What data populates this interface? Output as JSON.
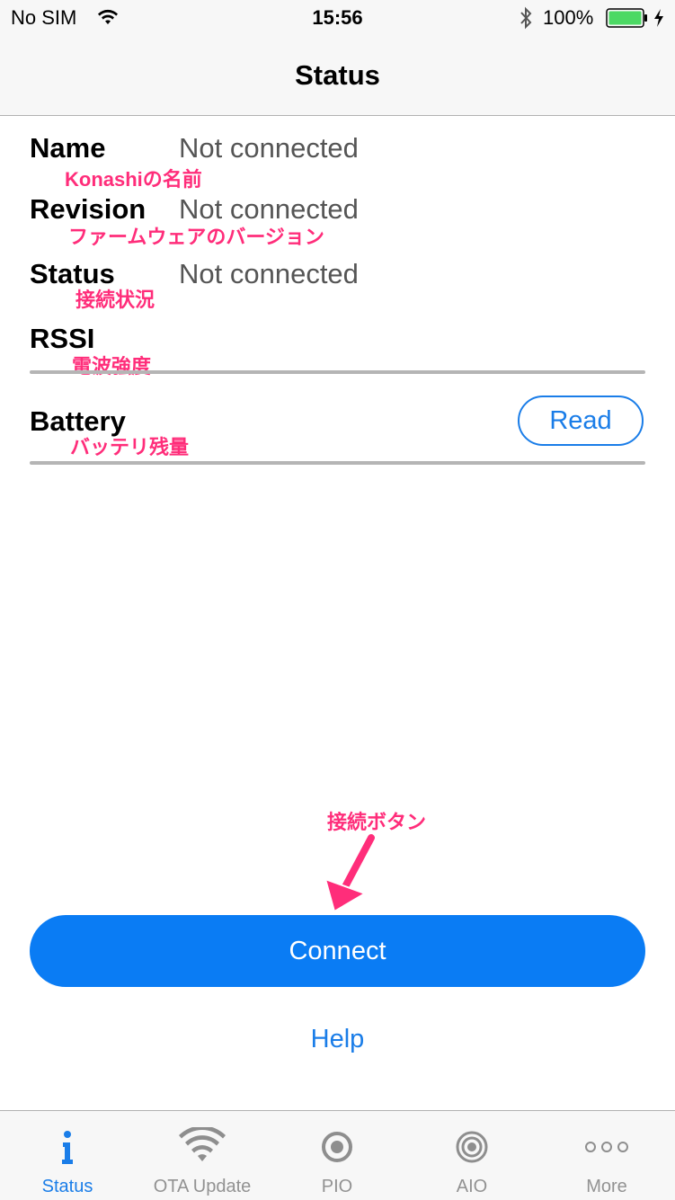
{
  "status_bar": {
    "carrier": "No SIM",
    "time": "15:56",
    "battery_pct": "100%",
    "battery_color": "#4cd964"
  },
  "nav": {
    "title": "Status"
  },
  "rows": {
    "name": {
      "label": "Name",
      "value": "Not connected",
      "annotation": "Konashiの名前"
    },
    "revision": {
      "label": "Revision",
      "value": "Not connected",
      "annotation": "ファームウェアのバージョン"
    },
    "status": {
      "label": "Status",
      "value": "Not connected",
      "annotation": "接続状況"
    },
    "rssi": {
      "label": "RSSI",
      "annotation": "電波強度"
    },
    "battery": {
      "label": "Battery",
      "annotation": "バッテリ残量",
      "read_label": "Read"
    }
  },
  "connect": {
    "label": "Connect",
    "annotation": "接続ボタン"
  },
  "help": {
    "label": "Help"
  },
  "tabs": [
    {
      "label": "Status",
      "icon": "info-icon",
      "active": true
    },
    {
      "label": "OTA Update",
      "icon": "wifi-icon",
      "active": false
    },
    {
      "label": "PIO",
      "icon": "radio-circle-icon",
      "active": false
    },
    {
      "label": "AIO",
      "icon": "target-icon",
      "active": false
    },
    {
      "label": "More",
      "icon": "more-dots-icon",
      "active": false
    }
  ],
  "colors": {
    "accent": "#1a7de8",
    "connect_button": "#0a7cf4",
    "annotation": "#ff2d7a"
  }
}
